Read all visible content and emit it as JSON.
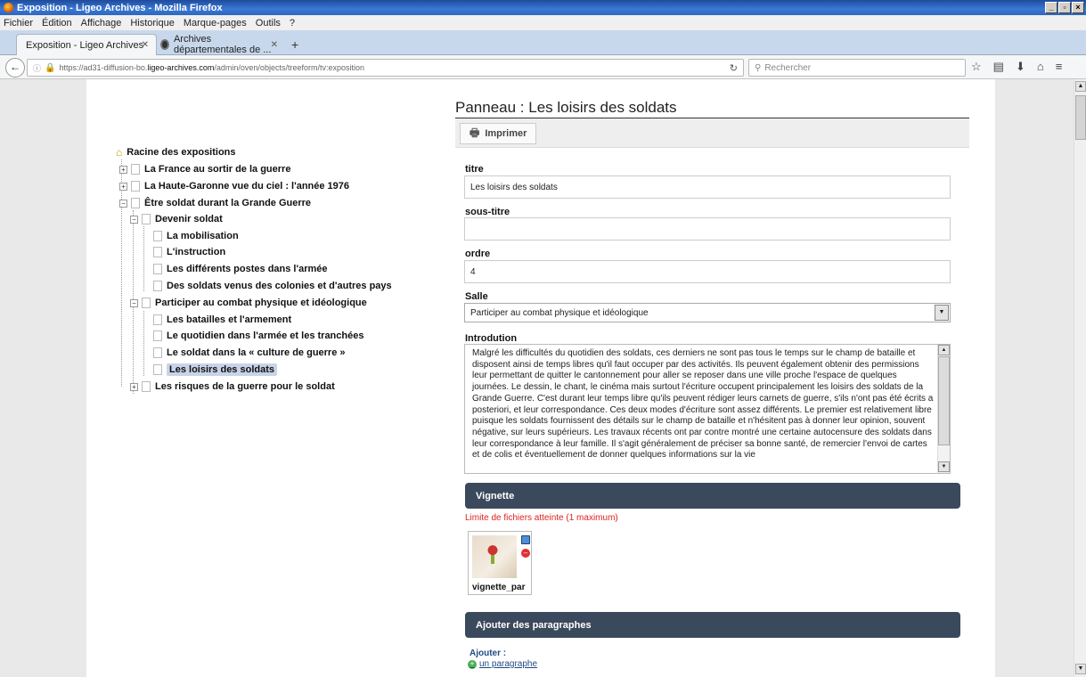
{
  "window": {
    "title": "Exposition - Ligeo Archives - Mozilla Firefox"
  },
  "menu": [
    "Fichier",
    "Édition",
    "Affichage",
    "Historique",
    "Marque-pages",
    "Outils",
    "?"
  ],
  "tabs": [
    {
      "label": "Exposition - Ligeo Archives",
      "active": true
    },
    {
      "label": "Archives départementales de ...",
      "active": false
    }
  ],
  "navbar": {
    "url_prefix": "https://ad31-diffusion-bo.",
    "url_domain": "ligeo-archives.com",
    "url_path": "/admin/oven/objects/treeform/tv:exposition",
    "search_placeholder": "Rechercher"
  },
  "tree": {
    "root": "Racine des expositions",
    "nodes": [
      {
        "label": "La France au sortir de la guerre",
        "level": 1,
        "expand": "+"
      },
      {
        "label": "La Haute-Garonne vue du ciel : l'année 1976",
        "level": 1,
        "expand": "+"
      },
      {
        "label": "Être soldat durant la Grande Guerre",
        "level": 1,
        "expand": "-"
      },
      {
        "label": "Devenir soldat",
        "level": 2,
        "expand": "-"
      },
      {
        "label": "La mobilisation",
        "level": 3,
        "expand": ""
      },
      {
        "label": "L'instruction",
        "level": 3,
        "expand": ""
      },
      {
        "label": "Les différents postes dans l'armée",
        "level": 3,
        "expand": ""
      },
      {
        "label": "Des soldats venus des colonies et d'autres pays",
        "level": 3,
        "expand": ""
      },
      {
        "label": "Participer au combat physique et idéologique",
        "level": 2,
        "expand": "-"
      },
      {
        "label": "Les batailles et l'armement",
        "level": 3,
        "expand": ""
      },
      {
        "label": "Le quotidien dans l'armée et les tranchées",
        "level": 3,
        "expand": ""
      },
      {
        "label": "Le soldat dans la « culture de guerre »",
        "level": 3,
        "expand": ""
      },
      {
        "label": "Les loisirs des soldats",
        "level": 3,
        "expand": "",
        "selected": true
      },
      {
        "label": "Les risques de la guerre pour le soldat",
        "level": 2,
        "expand": "+"
      }
    ]
  },
  "form": {
    "panel_title": "Panneau : Les loisirs des soldats",
    "print_label": "Imprimer",
    "titre_label": "titre",
    "titre_value": "Les loisirs des soldats",
    "soustitre_label": "sous-titre",
    "soustitre_value": "",
    "ordre_label": "ordre",
    "ordre_value": "4",
    "salle_label": "Salle",
    "salle_value": "Participer au combat physique et idéologique",
    "intro_label": "Introdution",
    "intro_text": "Malgré les difficultés du quotidien des soldats, ces derniers ne sont pas tous le temps sur le champ de bataille et disposent ainsi de temps libres qu'il faut occuper par des activités. Ils peuvent également obtenir des permissions leur permettant de quitter le cantonnement pour aller se reposer dans une ville proche l'espace de quelques journées. Le dessin, le chant, le cinéma mais surtout l'écriture occupent principalement les loisirs des soldats de la Grande Guerre. C'est durant leur temps libre qu'ils peuvent rédiger leurs carnets de guerre, s'ils n'ont pas été écrits a posteriori, et leur correspondance. Ces deux modes d'écriture sont assez différents. Le premier est relativement libre puisque les soldats fournissent des détails sur le champ de bataille et n'hésitent pas à donner leur opinion, souvent négative, sur leurs supérieurs. Les travaux récents ont par contre montré une certaine autocensure des soldats dans leur correspondance à leur famille. Il s'agit généralement de préciser sa bonne santé, de remercier l'envoi de cartes et de colis et éventuellement de donner quelques informations sur la vie",
    "vignette_header": "Vignette",
    "vignette_limit": "Limite de fichiers atteinte (1 maximum)",
    "vignette_filename": "vignette_par",
    "paragraphs_header": "Ajouter des paragraphes",
    "add_label": "Ajouter :",
    "add_link": "un paragraphe"
  }
}
